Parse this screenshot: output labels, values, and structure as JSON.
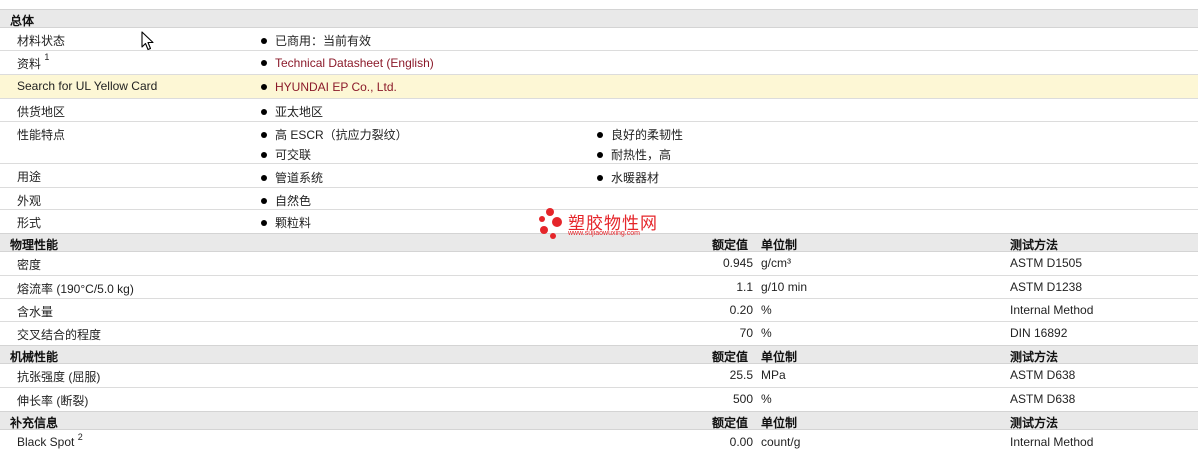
{
  "sections": {
    "general": "总体",
    "physical": "物理性能",
    "mechanical": "机械性能",
    "supplemental": "补充信息"
  },
  "headers": {
    "nominal": "额定值",
    "unit": "单位制",
    "method": "测试方法"
  },
  "general": {
    "material_status": {
      "label": "材料状态",
      "value": "已商用：当前有效"
    },
    "documents": {
      "label": "资料",
      "sup": "1",
      "value": "Technical Datasheet (English)"
    },
    "ul_search": {
      "label": "Search for UL Yellow Card",
      "value": "HYUNDAI EP Co., Ltd."
    },
    "availability": {
      "label": "供货地区",
      "value": "亚太地区"
    },
    "features": {
      "label": "性能特点",
      "items": [
        "高 ESCR（抗应力裂纹）",
        "良好的柔韧性",
        "可交联",
        "耐热性，高"
      ]
    },
    "uses": {
      "label": "用途",
      "items": [
        "管道系统",
        "水暖器材"
      ]
    },
    "appearance": {
      "label": "外观",
      "value": "自然色"
    },
    "form": {
      "label": "形式",
      "value": "颗粒料"
    }
  },
  "physical_rows": [
    {
      "name": "密度",
      "value": "0.945",
      "unit": "g/cm³",
      "method": "ASTM D1505"
    },
    {
      "name": "熔流率 (190°C/5.0 kg)",
      "value": "1.1",
      "unit": "g/10 min",
      "method": "ASTM D1238"
    },
    {
      "name": "含水量",
      "value": "0.20",
      "unit": "%",
      "method": "Internal Method"
    },
    {
      "name": "交叉结合的程度",
      "value": "70",
      "unit": "%",
      "method": "DIN 16892"
    }
  ],
  "mechanical_rows": [
    {
      "name": "抗张强度 (屈服)",
      "value": "25.5",
      "unit": "MPa",
      "method": "ASTM D638"
    },
    {
      "name": "伸长率 (断裂)",
      "value": "500",
      "unit": "%",
      "method": "ASTM D638"
    }
  ],
  "supplemental_rows": [
    {
      "name": "Black Spot",
      "sup": "2",
      "value": "0.00",
      "unit": "count/g",
      "method": "Internal Method"
    }
  ],
  "watermark": {
    "name": "塑胶物性网",
    "url": "www.sujiaowuxing.com"
  },
  "colors": {
    "section_bg": "#e9e9e9",
    "highlight_bg": "#fdf7d5",
    "link": "#8b1a2a",
    "logo": "#e5252a"
  },
  "icons": [
    "bullet-dot",
    "mouse-cursor-icon",
    "logo-dots-icon"
  ]
}
